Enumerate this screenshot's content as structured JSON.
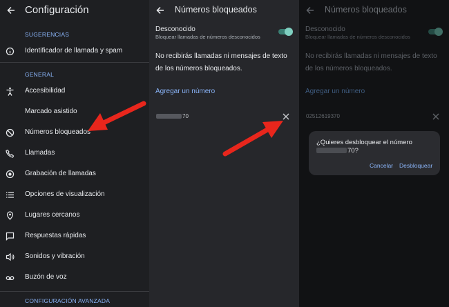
{
  "left_panel": {
    "title": "Configuración",
    "section_suggestions": "SUGERENCIAS",
    "section_general": "GENERAL",
    "section_advanced": "CONFIGURACIÓN AVANZADA",
    "items": [
      {
        "label": "Identificador de llamada y spam",
        "icon": "info-icon"
      },
      {
        "label": "Accesibilidad",
        "icon": "accessibility-icon"
      },
      {
        "label": "Marcado asistido",
        "icon": "none"
      },
      {
        "label": "Números bloqueados",
        "icon": "block-icon"
      },
      {
        "label": "Llamadas",
        "icon": "phone-icon"
      },
      {
        "label": "Grabación de llamadas",
        "icon": "record-icon"
      },
      {
        "label": "Opciones de visualización",
        "icon": "list-icon"
      },
      {
        "label": "Lugares cercanos",
        "icon": "location-icon"
      },
      {
        "label": "Respuestas rápidas",
        "icon": "message-icon"
      },
      {
        "label": "Sonidos y vibración",
        "icon": "volume-icon"
      },
      {
        "label": "Buzón de voz",
        "icon": "voicemail-icon"
      }
    ]
  },
  "middle_panel": {
    "title": "Números bloqueados",
    "unknown_title": "Desconocido",
    "unknown_sub": "Bloquear llamadas de números desconocidos",
    "unknown_enabled": true,
    "info": "No recibirás llamadas ni mensajes de texto de los números bloqueados.",
    "add_number": "Agregar un número",
    "blocked_suffix": "70"
  },
  "right_panel": {
    "title": "Números bloqueados",
    "unknown_title": "Desconocido",
    "unknown_sub": "Bloquear llamadas de números desconocidos",
    "info": "No recibirás llamadas ni mensajes de texto de los números bloqueados.",
    "add_number": "Agregar un número",
    "blocked_number": "02512619370"
  },
  "dialog": {
    "question_start": "¿Quieres desbloquear el número",
    "question_end": "70?",
    "cancel": "Cancelar",
    "confirm": "Desbloquear"
  },
  "colors": {
    "accent": "#8ab4f8",
    "arrow": "#e8261c",
    "toggle": "#7fcfc0"
  }
}
